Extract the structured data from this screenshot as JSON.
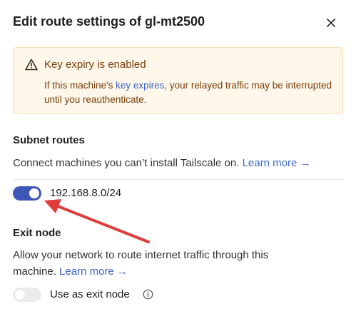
{
  "dialog": {
    "title": "Edit route settings of gl-mt2500",
    "close_icon": "close-icon"
  },
  "alert": {
    "icon": "warning-icon",
    "title": "Key expiry is enabled",
    "body_before": "If this machine's ",
    "body_link": "key expires",
    "body_after": ", your relayed traffic may be interrupted until you reauthenticate.",
    "colors": {
      "background": "#fef7ea",
      "border": "#f5dfb3",
      "text": "#7a3d0a"
    }
  },
  "subnet_routes": {
    "title": "Subnet routes",
    "description": "Connect machines you can’t install Tailscale on.",
    "learn_more": "Learn more →",
    "routes": [
      {
        "label": "192.168.8.0/24",
        "enabled": true
      }
    ]
  },
  "exit_node": {
    "title": "Exit node",
    "description": "Allow your network to route internet traffic through this machine.",
    "learn_more": "Learn more →",
    "toggle_label": "Use as exit node",
    "enabled": false,
    "info_icon": "info-icon"
  },
  "annotation": {
    "type": "red-arrow",
    "color": "#e03c3c",
    "points_to": "subnet-route-toggle"
  },
  "colors": {
    "accent": "#3e56b5",
    "link": "#3e67c7"
  }
}
